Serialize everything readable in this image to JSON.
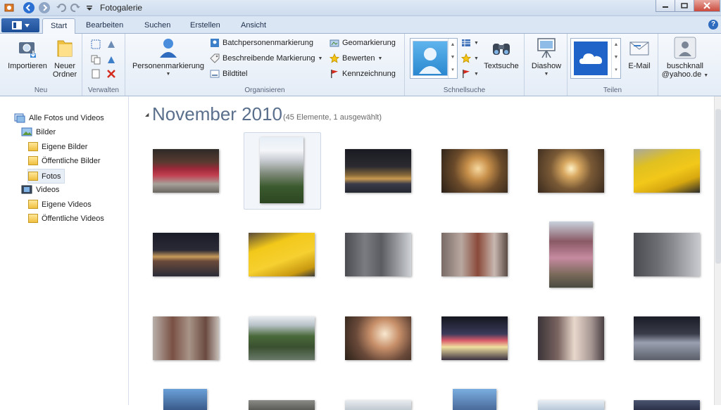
{
  "window": {
    "title": "Fotogalerie"
  },
  "tabs": [
    "Start",
    "Bearbeiten",
    "Suchen",
    "Erstellen",
    "Ansicht"
  ],
  "help": "?",
  "ribbon": {
    "neu": {
      "label": "Neu",
      "importieren": "Importieren",
      "neuer_ordner_1": "Neuer",
      "neuer_ordner_2": "Ordner"
    },
    "verwalten": {
      "label": "Verwalten"
    },
    "organisieren": {
      "label": "Organisieren",
      "personenmarkierung": "Personenmarkierung",
      "batch": "Batchpersonenmarkierung",
      "beschreibende": "Beschreibende Markierung",
      "bildtitel": "Bildtitel",
      "geomarkierung": "Geomarkierung",
      "bewerten": "Bewerten",
      "kennzeichnung": "Kennzeichnung"
    },
    "schnellsuche": {
      "label": "Schnellsuche",
      "textsuche": "Textsuche"
    },
    "diashow": "Diashow",
    "teilen": {
      "label": "Teilen",
      "email": "E-Mail"
    },
    "account": {
      "line1": "buschknall",
      "line2": "@yahoo.de"
    }
  },
  "tree": {
    "root": "Alle Fotos und Videos",
    "bilder": "Bilder",
    "eigene_bilder": "Eigene Bilder",
    "oeffentliche_bilder": "Öffentliche Bilder",
    "fotos": "Fotos",
    "videos": "Videos",
    "eigene_videos": "Eigene Videos",
    "oeffentliche_videos": "Öffentliche Videos"
  },
  "gallery": {
    "month": "November 2010",
    "count": "(45 Elemente, 1 ausgewählt)"
  },
  "colors": {
    "accent": "#1d4f98",
    "month_text": "#5a6f8c",
    "taxi": "#f2c81a"
  }
}
